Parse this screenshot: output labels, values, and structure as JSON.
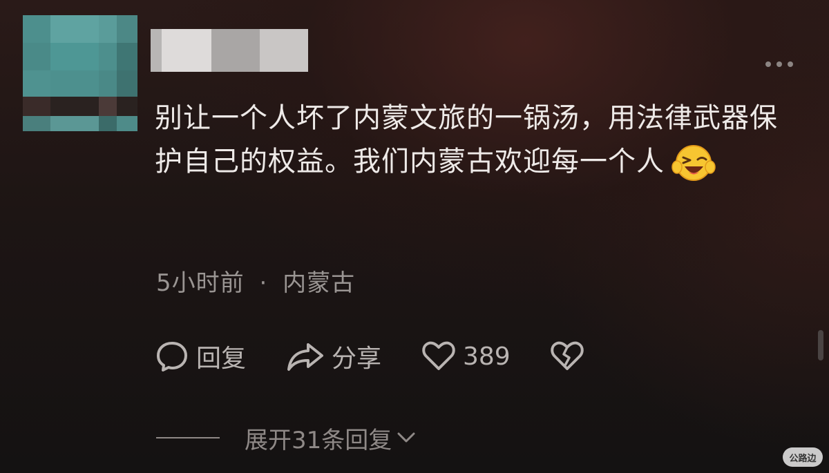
{
  "comment": {
    "text": "别让一个人坏了内蒙文旅的一锅汤，用法律武器保护自己的权益。我们内蒙古欢迎每一个人",
    "emoji": "laughing-face-emoji",
    "time": "5小时前",
    "separator": "·",
    "location": "内蒙古"
  },
  "actions": {
    "reply_label": "回复",
    "share_label": "分享",
    "like_count": "389"
  },
  "expand_label": "展开31条回复",
  "watermark": "公路边",
  "icons": {
    "more": "more-icon",
    "reply": "reply-bubble-icon",
    "share": "share-arrow-icon",
    "like": "heart-icon",
    "dislike": "broken-heart-icon",
    "expand": "chevron-down-icon"
  },
  "colors": {
    "text": "#eeeae8",
    "meta": "#9a9593",
    "action": "#b9b4b2"
  }
}
